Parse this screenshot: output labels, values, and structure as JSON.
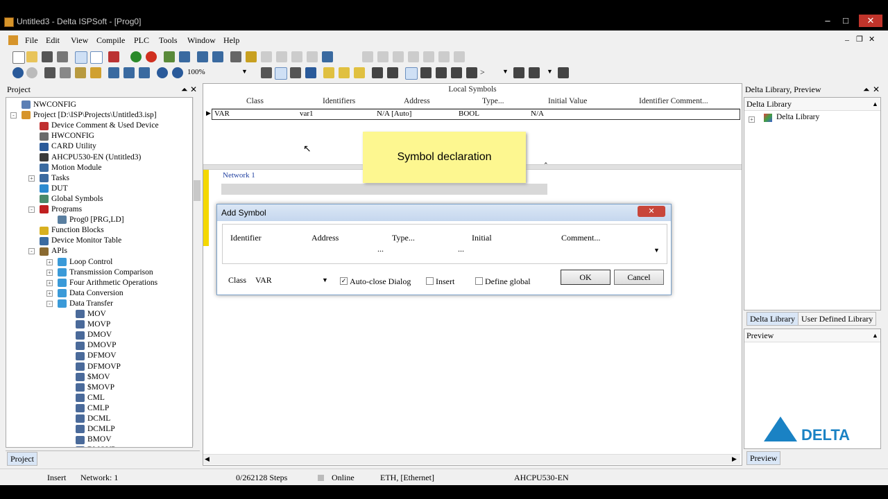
{
  "window": {
    "title": "Untitled3 - Delta ISPSoft - [Prog0]"
  },
  "menu": [
    "File",
    "Edit",
    "View",
    "Compile",
    "PLC",
    "Tools",
    "Window",
    "Help"
  ],
  "toolbar": {
    "zoom": "100%"
  },
  "project_panel": {
    "title": "Project",
    "tab": "Project",
    "tree": [
      {
        "label": "NWCONFIG"
      },
      {
        "label": "Project [D:\\ISP\\Projects\\Untitled3.isp]"
      },
      {
        "label": "Device Comment & Used Device"
      },
      {
        "label": "HWCONFIG"
      },
      {
        "label": "CARD Utility"
      },
      {
        "label": "AHCPU530-EN  (Untitled3)"
      },
      {
        "label": "Motion Module"
      },
      {
        "label": "Tasks"
      },
      {
        "label": "DUT"
      },
      {
        "label": "Global Symbols"
      },
      {
        "label": "Programs"
      },
      {
        "label": "Prog0 [PRG,LD]"
      },
      {
        "label": "Function Blocks"
      },
      {
        "label": "Device Monitor Table"
      },
      {
        "label": "APIs"
      },
      {
        "label": "Loop Control"
      },
      {
        "label": "Transmission Comparison"
      },
      {
        "label": "Four Arithmetic Operations"
      },
      {
        "label": "Data Conversion"
      },
      {
        "label": "Data Transfer"
      },
      {
        "label": "MOV"
      },
      {
        "label": "MOVP"
      },
      {
        "label": "DMOV"
      },
      {
        "label": "DMOVP"
      },
      {
        "label": "DFMOV"
      },
      {
        "label": "DFMOVP"
      },
      {
        "label": "$MOV"
      },
      {
        "label": "$MOVP"
      },
      {
        "label": "CML"
      },
      {
        "label": "CMLP"
      },
      {
        "label": "DCML"
      },
      {
        "label": "DCMLP"
      },
      {
        "label": "BMOV"
      },
      {
        "label": "BMOVP"
      }
    ]
  },
  "local_symbols": {
    "title": "Local Symbols",
    "columns": [
      "Class",
      "Identifiers",
      "Address",
      "Type...",
      "Initial Value",
      "Identifier Comment..."
    ],
    "row": [
      "VAR",
      "var1",
      "N/A [Auto]",
      "BOOL",
      "N/A",
      ""
    ]
  },
  "callout": {
    "text": "Symbol declaration"
  },
  "network": {
    "label": "Network 1"
  },
  "add_symbol": {
    "title": "Add Symbol",
    "columns": [
      "Identifier",
      "Address",
      "Type...",
      "Initial",
      "Comment..."
    ],
    "ellipsis_type": "...",
    "ellipsis_initial": "...",
    "class_label": "Class",
    "class_value": "VAR",
    "auto_close": "Auto-close Dialog",
    "insert": "Insert",
    "define_global": "Define global",
    "ok": "OK",
    "cancel": "Cancel"
  },
  "library_panel": {
    "title": "Delta Library, Preview",
    "section": "Delta Library",
    "root": "Delta Library",
    "tab1": "Delta Library",
    "tab2": "User Defined Library",
    "preview_label": "Preview",
    "preview_tab": "Preview",
    "logo_text": "DELTA"
  },
  "status": {
    "mode": "Insert",
    "network": "Network: 1",
    "steps": "0/262128 Steps",
    "online": "Online",
    "conn": "ETH, [Ethernet]",
    "device": "AHCPU530-EN"
  }
}
